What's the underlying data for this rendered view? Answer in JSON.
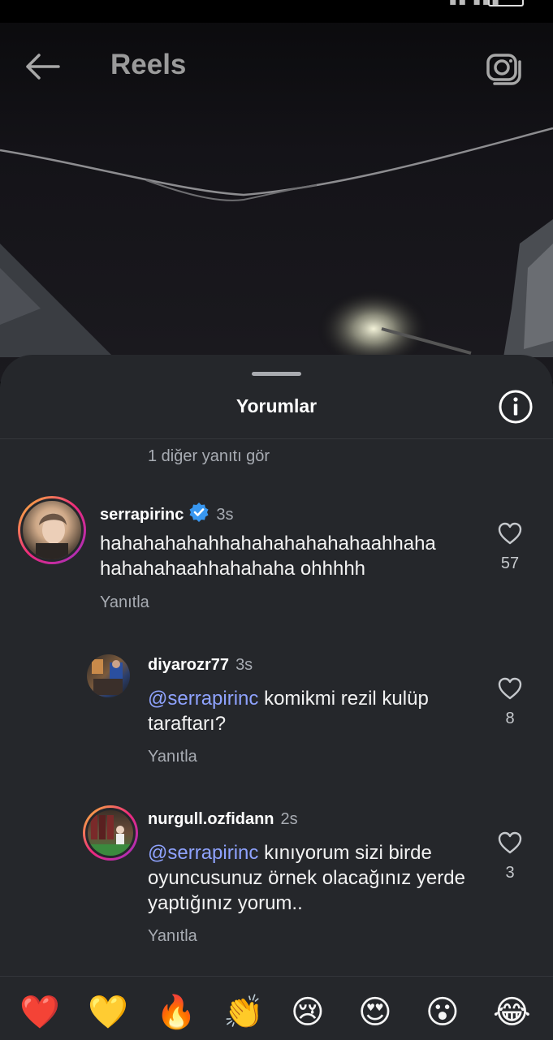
{
  "app": {
    "title": "Reels"
  },
  "sheet": {
    "title": "Yorumlar",
    "view_more_replies": "1 diğer yanıtı gör"
  },
  "comments": [
    {
      "username": "serrapirinc",
      "verified": true,
      "time": "3s",
      "text": "hahahahahahhahahahahahahaahhaha hahahahaahhahahaha ohhhhh",
      "reply_label": "Yanıtla",
      "likes": "57"
    },
    {
      "username": "diyarozr77",
      "time": "3s",
      "mention": "@serrapirinc",
      "text": " komikmi rezil kulüp taraftarı?",
      "reply_label": "Yanıtla",
      "likes": "8"
    },
    {
      "username": "nurgull.ozfidann",
      "time": "2s",
      "mention": "@serrapirinc",
      "text": " kınıyorum sizi birde oyuncusunuz örnek olacağınız yerde yaptığınız yorum..",
      "reply_label": "Yanıtla",
      "likes": "3"
    }
  ],
  "emoji_reactions": [
    "❤️",
    "💛",
    "🔥",
    "👏",
    "😢",
    "😍",
    "😮",
    "😂"
  ],
  "colors": {
    "sheet_bg": "#25272b",
    "mention": "#8fa3ff",
    "verified": "#3897f0",
    "secondary_text": "#a8acb3"
  }
}
